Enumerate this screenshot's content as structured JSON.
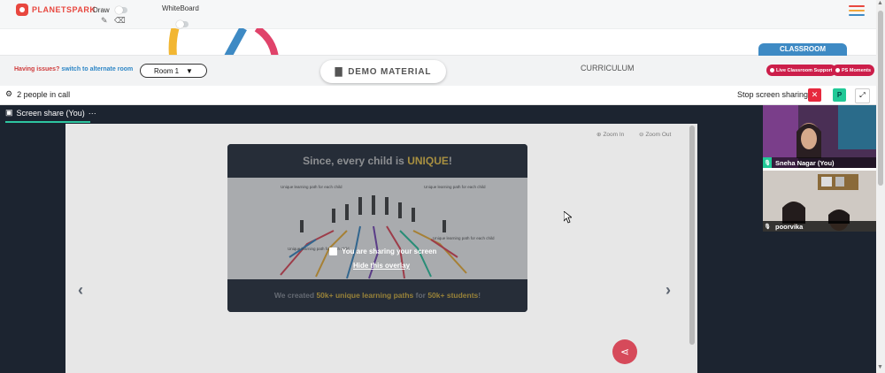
{
  "app": {
    "brand": "PLANETSPARK"
  },
  "toolbar": {
    "draw_label": "Draw",
    "whiteboard_label": "WhiteBoard"
  },
  "classbar": {
    "issues_text": "Having issues?",
    "alternate_link": "switch to alternate room",
    "room_selected": "Room 1",
    "demo_material": "DEMO MATERIAL",
    "curriculum": "CURRICULUM",
    "classroom_tab": "CLASSROOM",
    "live_support": "Live Classroom Support",
    "ps_moments": "PS Moments"
  },
  "call": {
    "people_count": "2 people in call",
    "stop_sharing": "Stop screen sharing",
    "p_button": "P"
  },
  "stage": {
    "tab_label": "Screen share (You)",
    "tab_more": "···",
    "zoom_in": "Zoom In",
    "zoom_out": "Zoom Out",
    "overlay_message": "You are sharing your screen",
    "hide_overlay": "Hide this overlay"
  },
  "slide": {
    "title_prefix": "Since, every child is ",
    "title_highlight": "UNIQUE",
    "title_suffix": "!",
    "footer_prefix": "We created ",
    "footer_h1": "50k+ unique learning paths",
    "footer_mid": " for ",
    "footer_h2": "50k+ students",
    "footer_suffix": "!",
    "path_labels": [
      "Unique learning path for each child",
      "Unique learning path for each child",
      "Unique learning path for each child",
      "Unique learning path for each child"
    ]
  },
  "participants": [
    {
      "name": "Sneha Nagar (You)"
    },
    {
      "name": "poorvika"
    }
  ],
  "colors": {
    "brand_red": "#e8473f",
    "classroom_blue": "#3e8ac4",
    "pink": "#cc1e4a",
    "green": "#21c997",
    "stop_red": "#e6283d"
  },
  "hamburger_colors": [
    "#e8473f",
    "#f2a53b",
    "#3e8ac4"
  ]
}
